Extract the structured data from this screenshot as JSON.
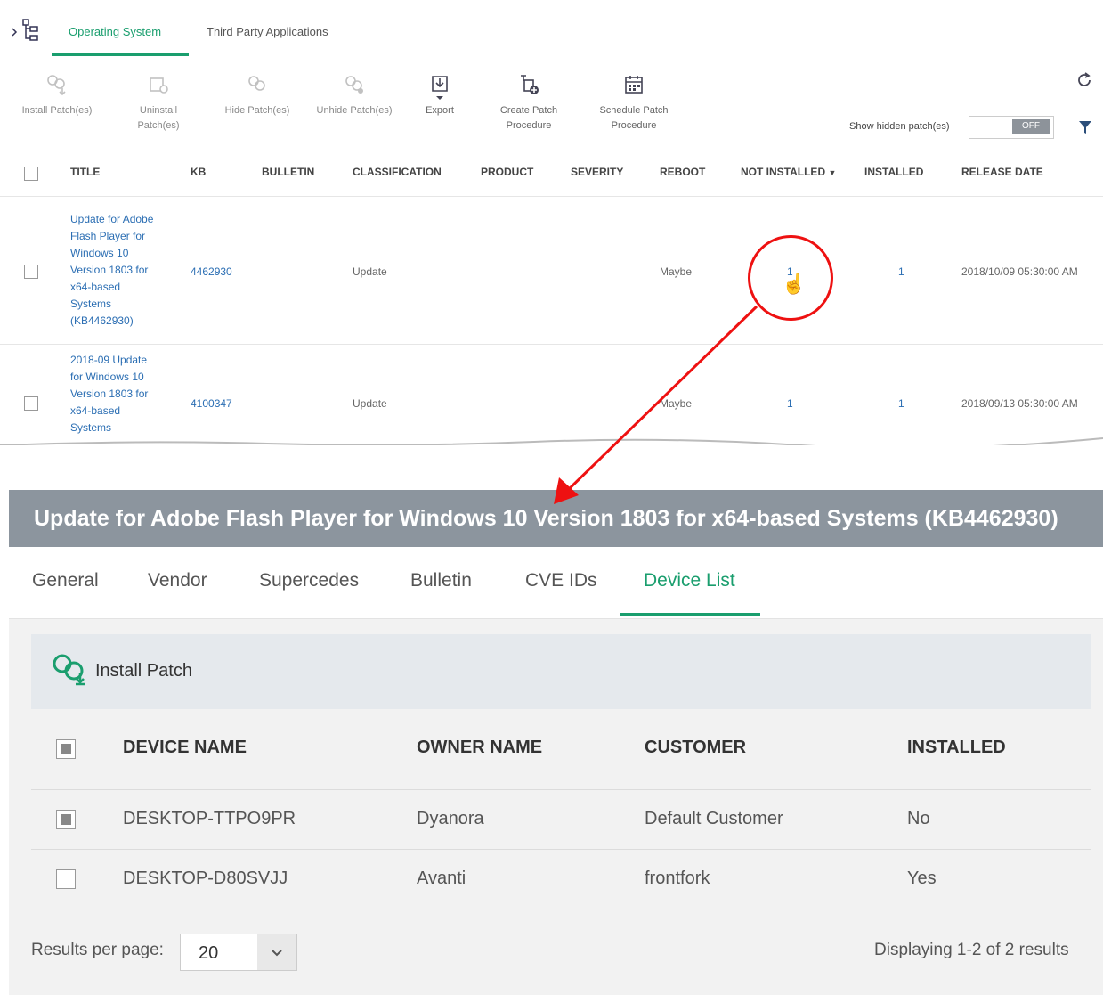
{
  "top": {
    "tabs": [
      {
        "label": "Operating System",
        "active": true
      },
      {
        "label": "Third Party Applications",
        "active": false
      }
    ],
    "toolbar": {
      "install": [
        "Install Patch(es)"
      ],
      "uninstall": [
        "Uninstall",
        "Patch(es)"
      ],
      "hide": [
        "Hide Patch(es)"
      ],
      "unhide": [
        "Unhide Patch(es)"
      ],
      "export": [
        "Export"
      ],
      "create": [
        "Create Patch",
        "Procedure"
      ],
      "schedule": [
        "Schedule Patch",
        "Procedure"
      ]
    },
    "show_hidden_label": "Show hidden patch(es)",
    "toggle_value": "OFF",
    "columns": {
      "title": "TITLE",
      "kb": "KB",
      "bulletin": "BULLETIN",
      "classification": "CLASSIFICATION",
      "product": "PRODUCT",
      "severity": "SEVERITY",
      "reboot": "REBOOT",
      "not_installed": "NOT INSTALLED",
      "installed": "INSTALLED",
      "release_date": "RELEASE DATE"
    },
    "rows": [
      {
        "title_lines": [
          "Update for Adobe",
          "Flash Player for",
          "Windows 10",
          "Version 1803 for",
          "x64-based",
          "Systems",
          "(KB4462930)"
        ],
        "kb": "4462930",
        "classification": "Update",
        "reboot": "Maybe",
        "not_installed": "1",
        "installed": "1",
        "release_date": "2018/10/09 05:30:00 AM"
      },
      {
        "title_lines": [
          "2018-09 Update",
          "for Windows 10",
          "Version 1803 for",
          "x64-based",
          "Systems"
        ],
        "kb": "4100347",
        "classification": "Update",
        "reboot": "Maybe",
        "not_installed": "1",
        "installed": "1",
        "release_date": "2018/09/13 05:30:00 AM"
      }
    ]
  },
  "detail": {
    "title": "Update for Adobe Flash Player for Windows 10 Version 1803 for x64-based Systems (KB4462930)",
    "tabs": [
      "General",
      "Vendor",
      "Supercedes",
      "Bulletin",
      "CVE IDs",
      "Device List"
    ],
    "active_tab": "Device List",
    "install_patch_label": "Install Patch",
    "columns": {
      "device_name": "DEVICE NAME",
      "owner_name": "OWNER NAME",
      "customer": "CUSTOMER",
      "installed": "INSTALLED"
    },
    "rows": [
      {
        "device": "DESKTOP-TTPO9PR",
        "owner": "Dyanora",
        "customer": "Default Customer",
        "installed": "No",
        "checked": true
      },
      {
        "device": "DESKTOP-D80SVJJ",
        "owner": "Avanti",
        "customer": "frontfork",
        "installed": "Yes",
        "checked": false
      }
    ],
    "results_per_page_label": "Results per page:",
    "results_per_page_value": "20",
    "displaying": "Displaying 1-2 of 2 results"
  },
  "colors": {
    "accent": "#1a9e6e",
    "link": "#2b6eb3",
    "banner": "#8c959e",
    "annotation": "#e11111"
  },
  "icons": [
    "tree-icon",
    "install-patch-icon",
    "uninstall-patch-icon",
    "hide-patch-icon",
    "unhide-patch-icon",
    "export-icon",
    "create-procedure-icon",
    "schedule-procedure-icon",
    "refresh-icon",
    "filter-icon",
    "pointer-hand-icon",
    "sort-desc-icon",
    "chevron-down-icon"
  ]
}
